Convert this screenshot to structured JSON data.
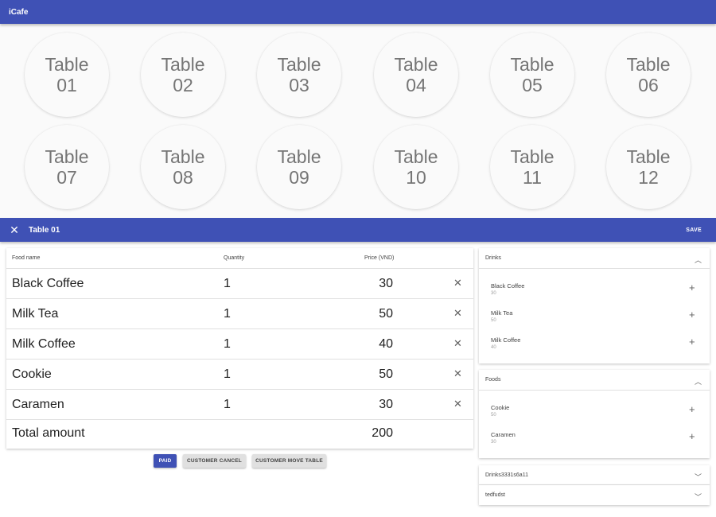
{
  "app": {
    "title": "iCafe"
  },
  "tables": [
    {
      "word": "Table",
      "num": "01"
    },
    {
      "word": "Table",
      "num": "02"
    },
    {
      "word": "Table",
      "num": "03"
    },
    {
      "word": "Table",
      "num": "04"
    },
    {
      "word": "Table",
      "num": "05"
    },
    {
      "word": "Table",
      "num": "06"
    },
    {
      "word": "Table",
      "num": "07"
    },
    {
      "word": "Table",
      "num": "08"
    },
    {
      "word": "Table",
      "num": "09"
    },
    {
      "word": "Table",
      "num": "10"
    },
    {
      "word": "Table",
      "num": "11"
    },
    {
      "word": "Table",
      "num": "12"
    }
  ],
  "dialog": {
    "close_icon": "✕",
    "title": "Table 01",
    "save_label": "SAVE"
  },
  "order": {
    "headers": {
      "name": "Food name",
      "qty": "Quantity",
      "price": "Price (VND)"
    },
    "rows": [
      {
        "name": "Black Coffee",
        "qty": "1",
        "price": "30"
      },
      {
        "name": "Milk Tea",
        "qty": "1",
        "price": "50"
      },
      {
        "name": "Milk Coffee",
        "qty": "1",
        "price": "40"
      },
      {
        "name": "Cookie",
        "qty": "1",
        "price": "50"
      },
      {
        "name": "Caramen",
        "qty": "1",
        "price": "30"
      }
    ],
    "remove_icon": "✕",
    "total_label": "Total amount",
    "total_value": "200"
  },
  "actions": {
    "paid": "PAID",
    "cancel": "CUSTOMER CANCEL",
    "move": "CUSTOMER MOVE TABLE"
  },
  "menu": {
    "add_icon": "+",
    "chevron_up": "︿",
    "chevron_down": "﹀",
    "drinks": {
      "title": "Drinks",
      "items": [
        {
          "name": "Black Coffee",
          "price": "30"
        },
        {
          "name": "Milk Tea",
          "price": "50"
        },
        {
          "name": "Milk Coffee",
          "price": "40"
        }
      ]
    },
    "foods": {
      "title": "Foods",
      "items": [
        {
          "name": "Cookie",
          "price": "50"
        },
        {
          "name": "Caramen",
          "price": "30"
        }
      ]
    },
    "collapsed": [
      {
        "title": "Drinks3331s6a11"
      },
      {
        "title": "tedfudst"
      }
    ]
  },
  "colors": {
    "primary": "#3f51b5",
    "background": "#fafafa"
  }
}
